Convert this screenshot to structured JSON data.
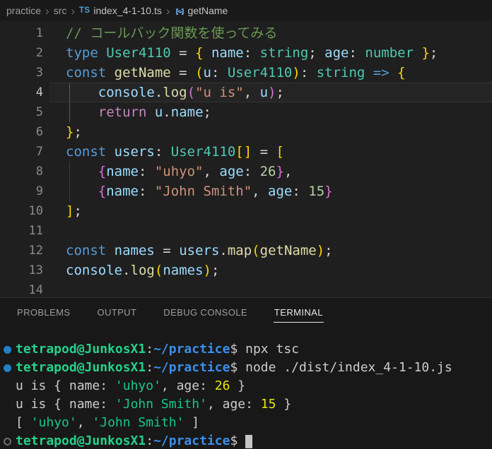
{
  "breadcrumb": {
    "root": "practice",
    "folder": "src",
    "file_icon": "TS",
    "file": "index_4-1-10.ts",
    "symbol": "getName"
  },
  "panel": {
    "tabs": [
      "PROBLEMS",
      "OUTPUT",
      "DEBUG CONSOLE",
      "TERMINAL"
    ],
    "active_tab": "TERMINAL"
  },
  "palette": {
    "keyword": "#569cd6",
    "control": "#c586c0",
    "type": "#4ec9b0",
    "variable": "#9cdcfe",
    "function": "#dcdcaa",
    "string": "#ce9178",
    "number": "#b5cea8",
    "comment": "#6a9955",
    "bracket_gold": "#ffd700",
    "bracket_pink": "#da70d6",
    "terminal_green": "#23d18b",
    "terminal_blue": "#3b8eea",
    "terminal_yellow": "#e5e510",
    "decoration_blue": "#2080c8"
  },
  "editor": {
    "lines": [
      {
        "num": "1",
        "tokens": [
          [
            "cm",
            "// コールバック関数を使ってみる"
          ]
        ]
      },
      {
        "num": "2",
        "tokens": [
          [
            "kw",
            "type"
          ],
          [
            "pl",
            " "
          ],
          [
            "ty",
            "User4110"
          ],
          [
            "pl",
            " = "
          ],
          [
            "b1",
            "{"
          ],
          [
            "pl",
            " "
          ],
          [
            "vr",
            "name"
          ],
          [
            "pl",
            ": "
          ],
          [
            "ty",
            "string"
          ],
          [
            "pl",
            "; "
          ],
          [
            "vr",
            "age"
          ],
          [
            "pl",
            ": "
          ],
          [
            "ty",
            "number"
          ],
          [
            "pl",
            " "
          ],
          [
            "b1",
            "}"
          ],
          [
            "pl",
            ";"
          ]
        ]
      },
      {
        "num": "3",
        "tokens": [
          [
            "kw",
            "const"
          ],
          [
            "pl",
            " "
          ],
          [
            "fn",
            "getName"
          ],
          [
            "pl",
            " = "
          ],
          [
            "b1",
            "("
          ],
          [
            "vr",
            "u"
          ],
          [
            "pl",
            ": "
          ],
          [
            "ty",
            "User4110"
          ],
          [
            "b1",
            ")"
          ],
          [
            "pl",
            ": "
          ],
          [
            "ty",
            "string"
          ],
          [
            "kw",
            " =>"
          ],
          [
            "pl",
            " "
          ],
          [
            "b1",
            "{"
          ]
        ]
      },
      {
        "num": "4",
        "current": true,
        "guide": "active",
        "tokens": [
          [
            "vr",
            "    console"
          ],
          [
            "pl",
            "."
          ],
          [
            "fn",
            "log"
          ],
          [
            "b2",
            "("
          ],
          [
            "st",
            "\"u is\""
          ],
          [
            "pl",
            ", "
          ],
          [
            "vr",
            "u"
          ],
          [
            "b2",
            ")"
          ],
          [
            "pl",
            ";"
          ]
        ]
      },
      {
        "num": "5",
        "guide": "active",
        "tokens": [
          [
            "ct",
            "    return"
          ],
          [
            "pl",
            " "
          ],
          [
            "vr",
            "u"
          ],
          [
            "pl",
            "."
          ],
          [
            "vr",
            "name"
          ],
          [
            "pl",
            ";"
          ]
        ]
      },
      {
        "num": "6",
        "tokens": [
          [
            "b1",
            "}"
          ],
          [
            "pl",
            ";"
          ]
        ]
      },
      {
        "num": "7",
        "tokens": [
          [
            "kw",
            "const"
          ],
          [
            "pl",
            " "
          ],
          [
            "vr",
            "users"
          ],
          [
            "pl",
            ": "
          ],
          [
            "ty",
            "User4110"
          ],
          [
            "b1",
            "[]"
          ],
          [
            "pl",
            " = "
          ],
          [
            "b1",
            "["
          ]
        ]
      },
      {
        "num": "8",
        "guide": "dim",
        "tokens": [
          [
            "b2",
            "    {"
          ],
          [
            "vr",
            "name"
          ],
          [
            "pl",
            ": "
          ],
          [
            "st",
            "\"uhyo\""
          ],
          [
            "pl",
            ", "
          ],
          [
            "vr",
            "age"
          ],
          [
            "pl",
            ": "
          ],
          [
            "nu",
            "26"
          ],
          [
            "b2",
            "}"
          ],
          [
            "pl",
            ","
          ]
        ]
      },
      {
        "num": "9",
        "guide": "dim",
        "tokens": [
          [
            "b2",
            "    {"
          ],
          [
            "vr",
            "name"
          ],
          [
            "pl",
            ": "
          ],
          [
            "st",
            "\"John Smith\""
          ],
          [
            "pl",
            ", "
          ],
          [
            "vr",
            "age"
          ],
          [
            "pl",
            ": "
          ],
          [
            "nu",
            "15"
          ],
          [
            "b2",
            "}"
          ]
        ]
      },
      {
        "num": "10",
        "tokens": [
          [
            "b1",
            "]"
          ],
          [
            "pl",
            ";"
          ]
        ]
      },
      {
        "num": "11",
        "tokens": []
      },
      {
        "num": "12",
        "tokens": [
          [
            "kw",
            "const"
          ],
          [
            "pl",
            " "
          ],
          [
            "vr",
            "names"
          ],
          [
            "pl",
            " = "
          ],
          [
            "vr",
            "users"
          ],
          [
            "pl",
            "."
          ],
          [
            "fn",
            "map"
          ],
          [
            "b1",
            "("
          ],
          [
            "fn",
            "getName"
          ],
          [
            "b1",
            ")"
          ],
          [
            "pl",
            ";"
          ]
        ]
      },
      {
        "num": "13",
        "tokens": [
          [
            "vr",
            "console"
          ],
          [
            "pl",
            "."
          ],
          [
            "fn",
            "log"
          ],
          [
            "b1",
            "("
          ],
          [
            "vr",
            "names"
          ],
          [
            "b1",
            ")"
          ],
          [
            "pl",
            ";"
          ]
        ]
      },
      {
        "num": "14",
        "tokens": []
      }
    ]
  },
  "terminal": {
    "lines": [
      {
        "deco": "run",
        "tokens": [
          [
            "pg",
            "tetrapod@JunkosX1"
          ],
          [
            "pw",
            ":"
          ],
          [
            "pb",
            "~/practice"
          ],
          [
            "pw",
            "$"
          ],
          [
            "cmd",
            " npx tsc"
          ]
        ]
      },
      {
        "deco": "run",
        "tokens": [
          [
            "pg",
            "tetrapod@JunkosX1"
          ],
          [
            "pw",
            ":"
          ],
          [
            "pb",
            "~/practice"
          ],
          [
            "pw",
            "$"
          ],
          [
            "cmd",
            " node ./dist/index_4-1-10.js"
          ]
        ]
      },
      {
        "tokens": [
          [
            "out",
            "u is { name: "
          ],
          [
            "str",
            "'uhyo'"
          ],
          [
            "out",
            ", age: "
          ],
          [
            "num",
            "26"
          ],
          [
            "out",
            " }"
          ]
        ]
      },
      {
        "tokens": [
          [
            "out",
            "u is { name: "
          ],
          [
            "str",
            "'John Smith'"
          ],
          [
            "out",
            ", age: "
          ],
          [
            "num",
            "15"
          ],
          [
            "out",
            " }"
          ]
        ]
      },
      {
        "tokens": [
          [
            "out",
            "[ "
          ],
          [
            "str",
            "'uhyo'"
          ],
          [
            "out",
            ", "
          ],
          [
            "str",
            "'John Smith'"
          ],
          [
            "out",
            " ]"
          ]
        ]
      },
      {
        "deco": "prompt",
        "cursor": true,
        "tokens": [
          [
            "pg",
            "tetrapod@JunkosX1"
          ],
          [
            "pw",
            ":"
          ],
          [
            "pb",
            "~/practice"
          ],
          [
            "pw",
            "$"
          ],
          [
            "cmd",
            " "
          ]
        ]
      }
    ]
  }
}
